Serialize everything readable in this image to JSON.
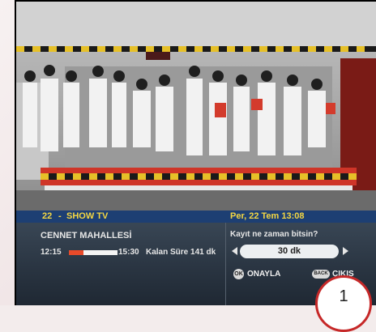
{
  "screen": {
    "channel_number": "22",
    "channel_separator": "-",
    "channel_name": "SHOW TV",
    "datetime": "Per, 22 Tem 13:08",
    "program_title": "CENNET MAHALLESİ",
    "start_time": "12:15",
    "end_time": "15:30",
    "remaining_text": "Kalan Süre 141 dk",
    "progress_percent": 30
  },
  "record_dialog": {
    "question": "Kayıt ne zaman bitsin?",
    "duration_value": "30 dk"
  },
  "buttons": {
    "ok_key": "OK",
    "ok_label": "ONAYLA",
    "back_key": "BACK",
    "back_label": "ÇIKIŞ"
  },
  "badge": {
    "number": "1"
  },
  "colors": {
    "header_bar": "#1d3f73",
    "header_text": "#f5d742",
    "progress_fill": "#e84a2a",
    "badge_border": "#c62828"
  }
}
